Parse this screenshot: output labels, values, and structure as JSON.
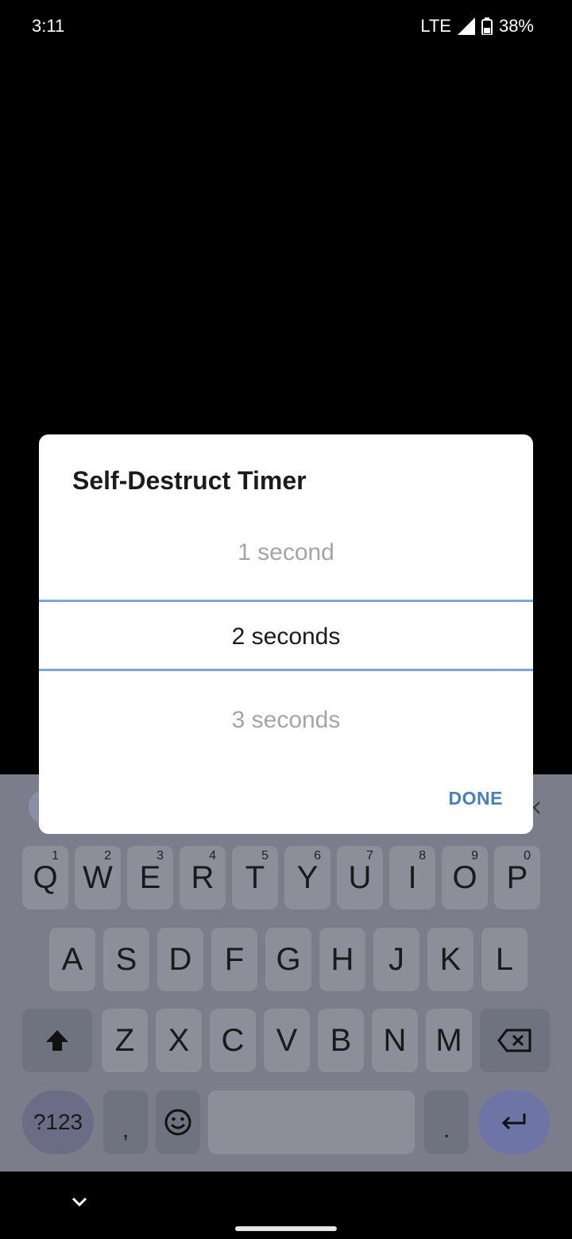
{
  "status": {
    "time": "3:11",
    "network": "LTE",
    "battery": "38%"
  },
  "dialog": {
    "title": "Self-Destruct Timer",
    "options": [
      {
        "label": "1 second",
        "state": "unselected"
      },
      {
        "label": "2 seconds",
        "state": "selected"
      },
      {
        "label": "3 seconds",
        "state": "unselected"
      }
    ],
    "done_label": "DONE"
  },
  "keyboard": {
    "row1": [
      {
        "key": "Q",
        "sup": "1"
      },
      {
        "key": "W",
        "sup": "2"
      },
      {
        "key": "E",
        "sup": "3"
      },
      {
        "key": "R",
        "sup": "4"
      },
      {
        "key": "T",
        "sup": "5"
      },
      {
        "key": "Y",
        "sup": "6"
      },
      {
        "key": "U",
        "sup": "7"
      },
      {
        "key": "I",
        "sup": "8"
      },
      {
        "key": "O",
        "sup": "9"
      },
      {
        "key": "P",
        "sup": "0"
      }
    ],
    "row2": [
      "A",
      "S",
      "D",
      "F",
      "G",
      "H",
      "J",
      "K",
      "L"
    ],
    "row3": [
      "Z",
      "X",
      "C",
      "V",
      "B",
      "N",
      "M"
    ],
    "symbols_label": "?123",
    "comma_label": ",",
    "period_label": ".",
    "icons": [
      "shift-icon",
      "backspace-icon",
      "emoji-icon",
      "enter-icon"
    ]
  },
  "colors": {
    "accent": "#4a7fb8",
    "divider": "#7ea6d6"
  }
}
